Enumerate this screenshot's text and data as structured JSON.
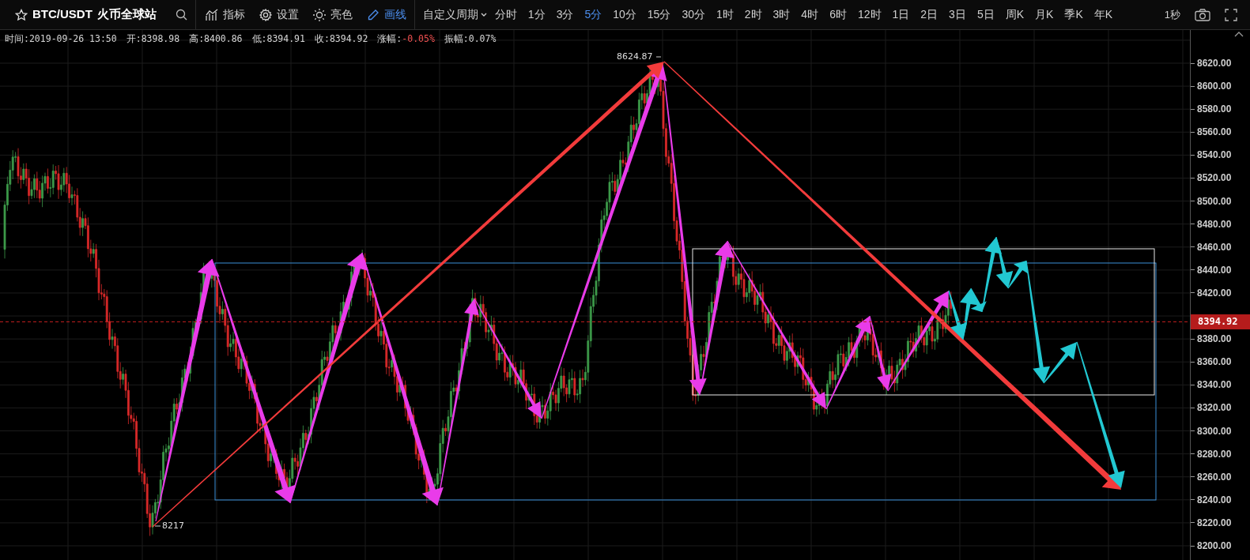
{
  "toolbar": {
    "symbol": "BTC/USDT",
    "exchange": "火币全球站",
    "tools": [
      {
        "kind": "indicator",
        "label": "指标",
        "selected": false
      },
      {
        "kind": "settings",
        "label": "设置",
        "selected": false
      },
      {
        "kind": "theme",
        "label": "亮色",
        "selected": false
      },
      {
        "kind": "draw",
        "label": "画线",
        "selected": true
      }
    ],
    "period_menu": "自定义周期",
    "periods": [
      {
        "label": "分时",
        "selected": false
      },
      {
        "label": "1分",
        "selected": false
      },
      {
        "label": "3分",
        "selected": false
      },
      {
        "label": "5分",
        "selected": true
      },
      {
        "label": "10分",
        "selected": false
      },
      {
        "label": "15分",
        "selected": false
      },
      {
        "label": "30分",
        "selected": false
      },
      {
        "label": "1时",
        "selected": false
      },
      {
        "label": "2时",
        "selected": false
      },
      {
        "label": "3时",
        "selected": false
      },
      {
        "label": "4时",
        "selected": false
      },
      {
        "label": "6时",
        "selected": false
      },
      {
        "label": "12时",
        "selected": false
      },
      {
        "label": "1日",
        "selected": false
      },
      {
        "label": "2日",
        "selected": false
      },
      {
        "label": "3日",
        "selected": false
      },
      {
        "label": "5日",
        "selected": false
      },
      {
        "label": "周K",
        "selected": false
      },
      {
        "label": "月K",
        "selected": false
      },
      {
        "label": "季K",
        "selected": false
      },
      {
        "label": "年K",
        "selected": false
      }
    ],
    "refresh": "1秒"
  },
  "info": [
    {
      "label": "时间:",
      "value": "2019-09-26 13:50",
      "color": "#d6d6d6"
    },
    {
      "label": "开:",
      "value": "8398.98",
      "color": "#d6d6d6"
    },
    {
      "label": "高:",
      "value": "8400.86",
      "color": "#d6d6d6"
    },
    {
      "label": "低:",
      "value": "8394.91",
      "color": "#d6d6d6"
    },
    {
      "label": "收:",
      "value": "8394.92",
      "color": "#d6d6d6"
    },
    {
      "label": "涨幅:",
      "value": "-0.05%",
      "color": "#f05050"
    },
    {
      "label": "振幅:",
      "value": "0.07%",
      "color": "#d6d6d6"
    }
  ],
  "chart": {
    "price_axis": [
      "8620.00",
      "8600.00",
      "8580.00",
      "8560.00",
      "8540.00",
      "8520.00",
      "8500.00",
      "8480.00",
      "8460.00",
      "8440.00",
      "8420.00",
      "8380.00",
      "8360.00",
      "8340.00",
      "8320.00",
      "8300.00",
      "8280.00",
      "8260.00",
      "8240.00",
      "8220.00",
      "8200.00"
    ],
    "last_price": "8394.92",
    "high_label": "8624.87",
    "low_label": "8217"
  }
}
